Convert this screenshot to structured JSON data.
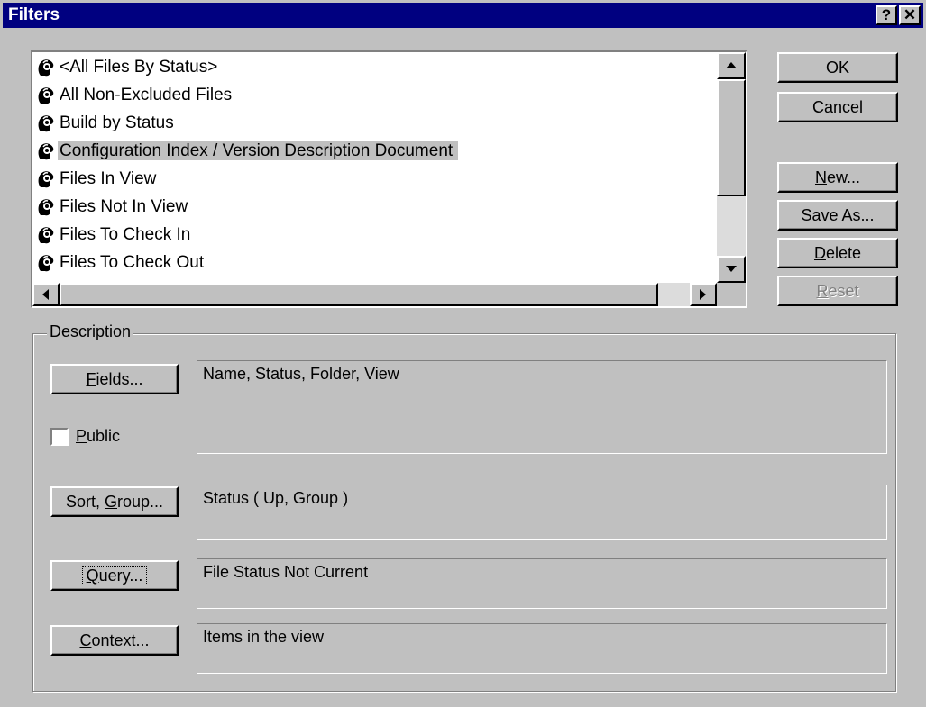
{
  "window": {
    "title": "Filters",
    "help_glyph": "?",
    "close_glyph": "✕"
  },
  "filters_list": {
    "items": [
      {
        "label": "<All Files By Status>",
        "icon": "filter-icon"
      },
      {
        "label": "All Non-Excluded Files",
        "icon": "filter-icon"
      },
      {
        "label": "Build by Status",
        "icon": "filter-icon"
      },
      {
        "label": "Configuration Index / Version Description Document",
        "icon": "filter-icon",
        "selected": true
      },
      {
        "label": "Files In View",
        "icon": "filter-icon"
      },
      {
        "label": "Files Not In View",
        "icon": "filter-icon"
      },
      {
        "label": "Files To Check In",
        "icon": "filter-icon"
      },
      {
        "label": "Files To Check Out",
        "icon": "filter-icon"
      }
    ]
  },
  "buttons": {
    "ok": "OK",
    "cancel": "Cancel",
    "new": {
      "pre": "",
      "key": "N",
      "post": "ew..."
    },
    "save_as": {
      "pre": "Save ",
      "key": "A",
      "post": "s..."
    },
    "delete": {
      "pre": "",
      "key": "D",
      "post": "elete"
    },
    "reset": {
      "pre": "",
      "key": "R",
      "post": "eset"
    }
  },
  "description": {
    "group_label": "Description",
    "fields_button": {
      "pre": "",
      "key": "F",
      "post": "ields..."
    },
    "fields_value": "Name, Status, Folder, View",
    "public_label": {
      "pre": "",
      "key": "P",
      "post": "ublic"
    },
    "public_checked": false,
    "sort_button": {
      "pre": "Sort, ",
      "key": "G",
      "post": "roup..."
    },
    "sort_value": "Status ( Up, Group )",
    "query_button": {
      "pre": "",
      "key": "Q",
      "post": "uery..."
    },
    "query_value": "File Status Not Current",
    "context_button": {
      "pre": "",
      "key": "C",
      "post": "ontext..."
    },
    "context_value": "Items in the view"
  }
}
